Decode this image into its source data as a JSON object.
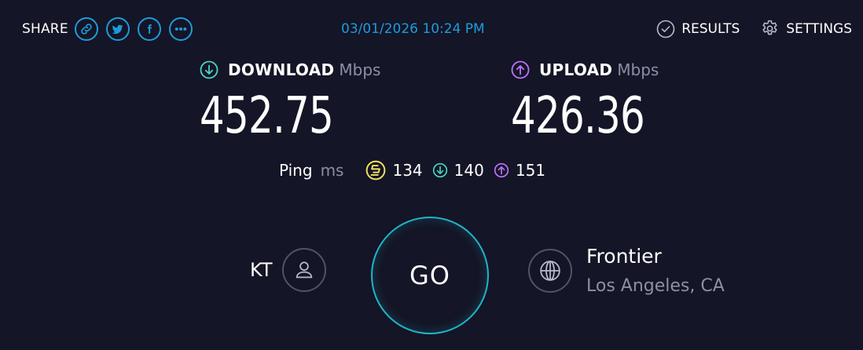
{
  "share": {
    "label": "SHARE",
    "buttons": [
      "link-icon",
      "twitter-icon",
      "facebook-icon",
      "more-icon"
    ]
  },
  "datetime": "03/01/2026 10:24 PM",
  "nav": {
    "results": "RESULTS",
    "settings": "SETTINGS"
  },
  "download": {
    "title": "DOWNLOAD",
    "unit": "Mbps",
    "value": "452.75",
    "color": "#48d6c3"
  },
  "upload": {
    "title": "UPLOAD",
    "unit": "Mbps",
    "value": "426.36",
    "color": "#bf71ff"
  },
  "ping": {
    "label": "Ping",
    "unit": "ms",
    "idle": "134",
    "download": "140",
    "upload": "151",
    "idle_color": "#f3e35e"
  },
  "go": "GO",
  "user": {
    "name": "KT"
  },
  "server": {
    "isp": "Frontier",
    "location": "Los Angeles, CA"
  }
}
